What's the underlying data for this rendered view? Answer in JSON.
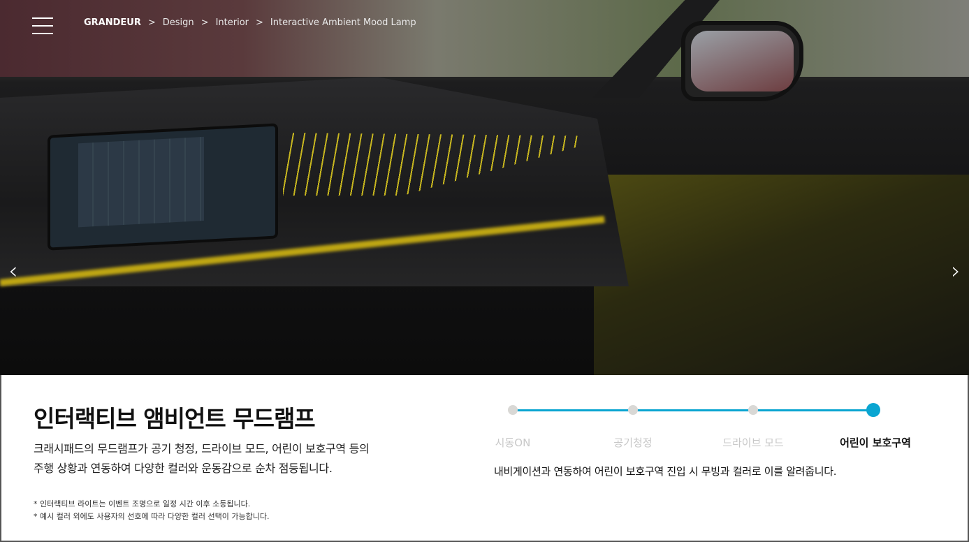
{
  "breadcrumb": [
    "GRANDEUR",
    "Design",
    "Interior",
    "Interactive Ambient Mood Lamp"
  ],
  "separator": ">",
  "nav": {
    "prev_icon": "‹",
    "next_icon": "›"
  },
  "content": {
    "title": "인터랙티브 앰비언트 무드램프",
    "description_lines": [
      "크래시패드의 무드램프가 공기 청정, 드라이브 모드, 어린이 보호구역 등의",
      "주행 상황과 연동하여 다양한 컬러와 운동감으로 순차 점등됩니다."
    ],
    "notes": [
      "* 인터랙티브 라이트는 이벤트 조명으로 일정 시간 이후 소등됩니다.",
      "* 예시 컬러 외에도 사용자의 선호에 따라 다양한 컬러 선택이 가능합니다."
    ]
  },
  "steps": {
    "items": [
      "시동ON",
      "공기청정",
      "드라이브 모드",
      "어린이 보호구역"
    ],
    "active_index": 3,
    "active_description": "내비게이션과 연동하여 어린이 보호구역 진입 시 무빙과 컬러로 이를 알려줍니다."
  },
  "colors": {
    "accent": "#0aa5d1",
    "inactive_dot": "#d9d8d5",
    "ambient_light": "#e5d11f"
  }
}
